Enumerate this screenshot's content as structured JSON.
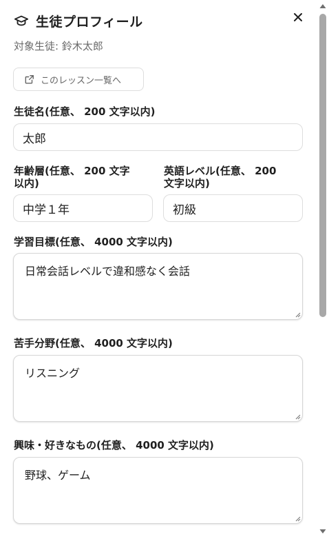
{
  "header": {
    "title": "生徒プロフィール",
    "subtitle": "対象生徒: 鈴木太郎",
    "cap_icon": "graduation-cap-icon",
    "close_icon": "close-icon"
  },
  "lesson_button": {
    "label": "このレッスン一覧へ",
    "icon": "external-link-icon"
  },
  "fields": {
    "student_name": {
      "label": "生徒名(任意、 200 文字以内)",
      "value": "太郎"
    },
    "age_group": {
      "label_line1": "年齢層(任意、 200 文字",
      "label_line2": "以内)",
      "value": "中学１年"
    },
    "english_level": {
      "label_line1": "英語レベル(任意、 200",
      "label_line2": "文字以内)",
      "value": "初級"
    },
    "goal": {
      "label": "学習目標(任意、 4000 文字以内)",
      "value": "日常会話レベルで違和感なく会話"
    },
    "weak_area": {
      "label": "苦手分野(任意、 4000 文字以内)",
      "value": "リスニング"
    },
    "interests": {
      "label": "興味・好きなもの(任意、 4000 文字以内)",
      "value": "野球、ゲーム"
    }
  },
  "colors": {
    "border": "#dddddd",
    "subtitle": "#6a6a6a",
    "scroll_thumb": "#a8a8a8"
  }
}
